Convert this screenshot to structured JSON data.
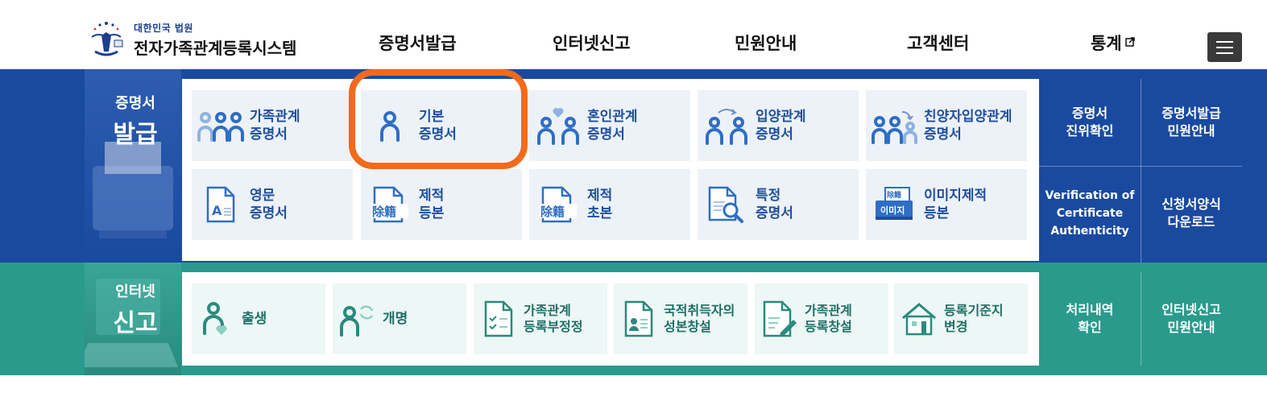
{
  "brand": {
    "sub": "대한민국 법원",
    "name": "전자가족관계등록시스템"
  },
  "nav": {
    "items": [
      "증명서발급",
      "인터넷신고",
      "민원안내",
      "고객센터",
      "통계"
    ]
  },
  "certificate": {
    "title_line1": "증명서",
    "title_line2": "발급",
    "tiles": [
      {
        "line1": "가족관계",
        "line2": "증명서"
      },
      {
        "line1": "기본",
        "line2": "증명서"
      },
      {
        "line1": "혼인관계",
        "line2": "증명서"
      },
      {
        "line1": "입양관계",
        "line2": "증명서"
      },
      {
        "line1": "친양자입양관계",
        "line2": "증명서"
      },
      {
        "line1": "영문",
        "line2": "증명서"
      },
      {
        "line1": "제적",
        "line2": "등본"
      },
      {
        "line1": "제적",
        "line2": "초본"
      },
      {
        "line1": "특정",
        "line2": "증명서"
      },
      {
        "line1": "이미지제적",
        "line2": "등본"
      }
    ],
    "side_links": [
      {
        "line1": "증명서",
        "line2": "진위확인"
      },
      {
        "line1": "증명서발급",
        "line2": "민원안내"
      },
      {
        "line1": "Verification of",
        "line2": "Certificate",
        "line3": "Authenticity"
      },
      {
        "line1": "신청서양식",
        "line2": "다운로드"
      }
    ]
  },
  "internet": {
    "title_line1": "인터넷",
    "title_line2": "신고",
    "tiles": [
      {
        "line1": "출생",
        "line2": ""
      },
      {
        "line1": "개명",
        "line2": ""
      },
      {
        "line1": "가족관계",
        "line2": "등록부정정"
      },
      {
        "line1": "국적취득자의",
        "line2": "성본창설"
      },
      {
        "line1": "가족관계",
        "line2": "등록창설"
      },
      {
        "line1": "등록기준지",
        "line2": "변경"
      }
    ],
    "side_links": [
      {
        "line1": "처리내역",
        "line2": "확인"
      },
      {
        "line1": "인터넷신고",
        "line2": "민원안내"
      }
    ]
  },
  "icon_labels": {
    "joseki": "除籍",
    "image_card": "이미지",
    "image_top": "除籍"
  },
  "colors": {
    "blue_band": "#1a4aa0",
    "green_band": "#2a9a8c",
    "highlight": "#f26a1b",
    "icon_blue": "#2f6ec4",
    "icon_green": "#2a8a7e"
  }
}
